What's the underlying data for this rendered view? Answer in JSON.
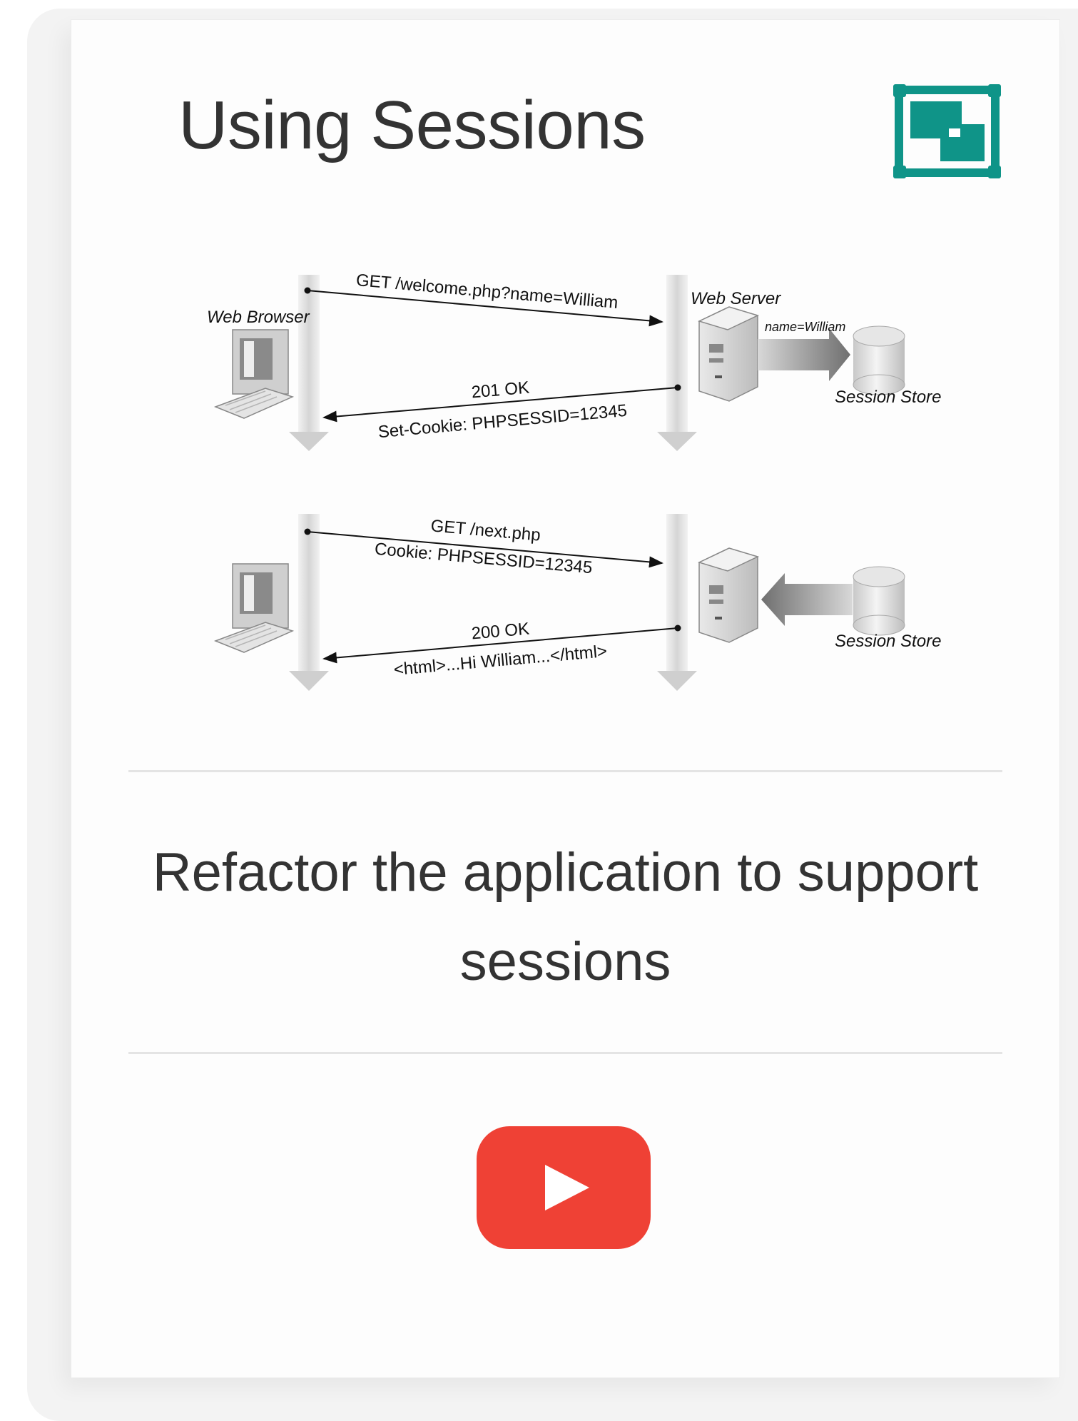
{
  "title": "Using Sessions",
  "description": "Refactor the application to support sessions",
  "diagram": {
    "web_browser_label": "Web Browser",
    "web_server_label": "Web Server",
    "session_store_label": "Session Store",
    "step1": {
      "request": "GET /welcome.php?name=William",
      "store_write": "name=William",
      "response_status": "201 OK",
      "response_header": "Set-Cookie: PHPSESSID=12345"
    },
    "step2": {
      "request": "GET /next.php",
      "request_header": "Cookie: PHPSESSID=12345",
      "response_status": "200 OK",
      "response_body": "<html>...Hi William...</html>"
    }
  },
  "icons": {
    "logo": "window-frame-icon",
    "video": "youtube-play-icon"
  },
  "colors": {
    "accent": "#0f9488",
    "youtube_red": "#ef4135",
    "text": "#333333",
    "divider": "#e4e4e4"
  }
}
